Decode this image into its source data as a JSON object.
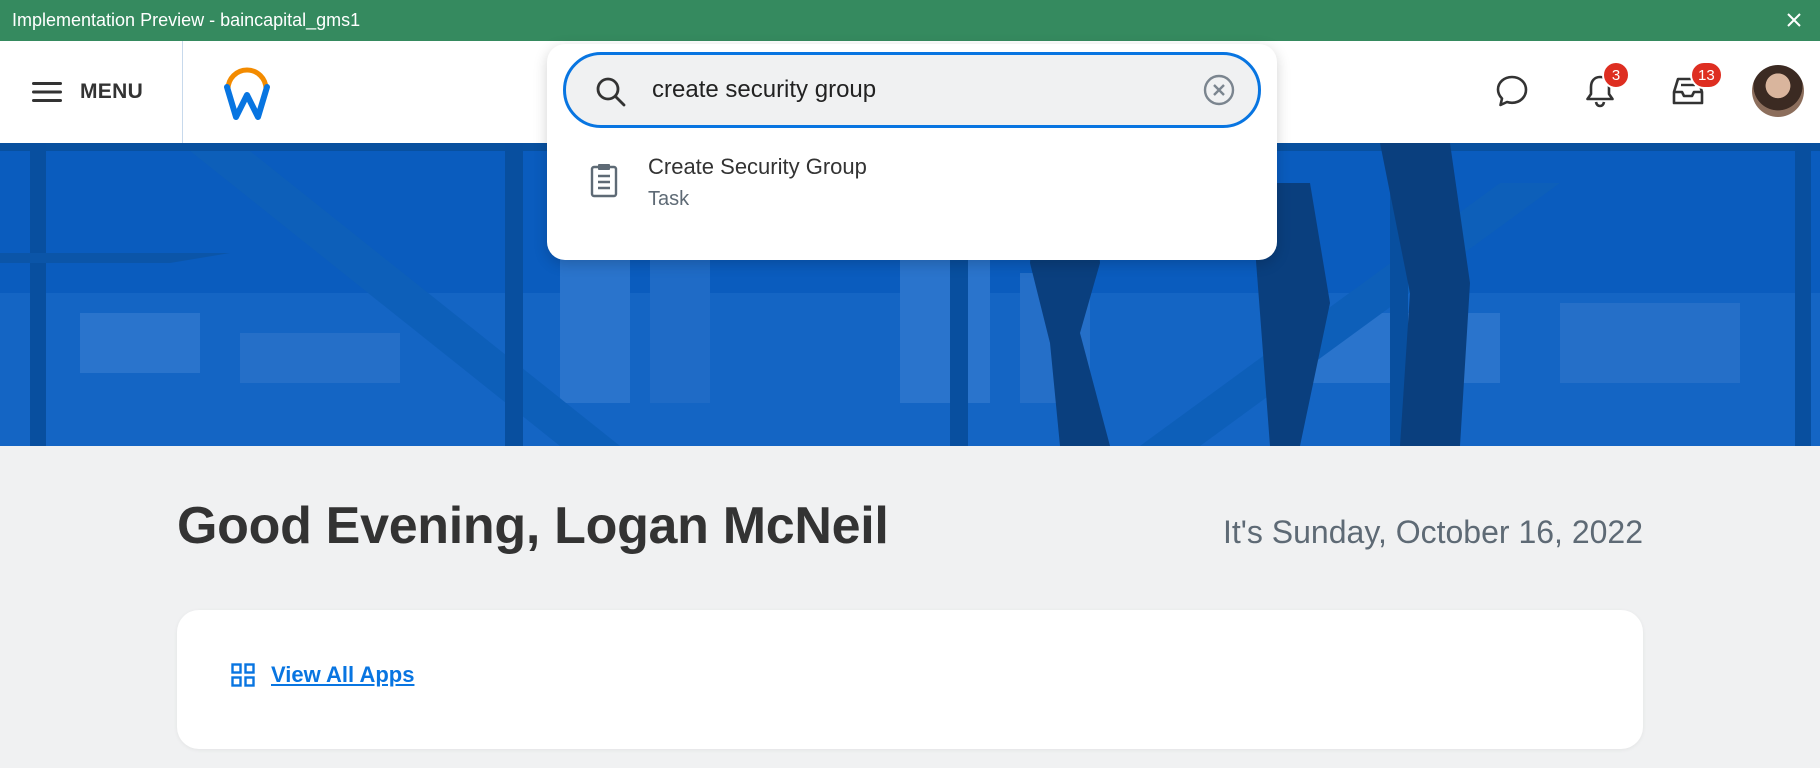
{
  "preview_bar": {
    "title": "Implementation Preview - baincapital_gms1"
  },
  "header": {
    "menu_label": "MENU",
    "notifications_count": "3",
    "inbox_count": "13"
  },
  "search": {
    "query": "create security group",
    "results": [
      {
        "title": "Create Security Group",
        "category": "Task"
      }
    ]
  },
  "greeting": {
    "text": "Good Evening, Logan McNeil",
    "date": "It's Sunday, October 16, 2022"
  },
  "apps": {
    "view_all_label": "View All Apps"
  },
  "colors": {
    "preview_bar": "#358a5f",
    "hero": "#0a5cbe",
    "accent": "#0875e1",
    "badge": "#de2e21",
    "logo_arc": "#f38b00"
  }
}
